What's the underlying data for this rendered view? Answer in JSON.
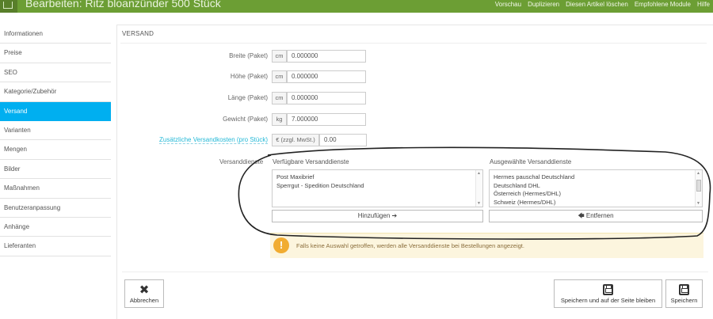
{
  "header": {
    "title": "Bearbeiten: Ritz bloanzünder 500 Stück",
    "actions": [
      "Vorschau",
      "Duplizieren",
      "Diesen Artikel löschen",
      "Empfohlene Module",
      "Hilfe"
    ]
  },
  "sidebar": {
    "items": [
      "Informationen",
      "Preise",
      "SEO",
      "Kategorie/Zubehör",
      "Versand",
      "Varianten",
      "Mengen",
      "Bilder",
      "Maßnahmen",
      "Benutzeranpassung",
      "Anhänge",
      "Lieferanten"
    ],
    "active_index": 4
  },
  "section": {
    "title": "VERSAND"
  },
  "fields": {
    "width": {
      "label": "Breite (Paket)",
      "unit": "cm",
      "value": "0.000000"
    },
    "height": {
      "label": "Höhe (Paket)",
      "unit": "cm",
      "value": "0.000000"
    },
    "depth": {
      "label": "Länge (Paket)",
      "unit": "cm",
      "value": "0.000000"
    },
    "weight": {
      "label": "Gewicht (Paket)",
      "unit": "kg",
      "value": "7.000000"
    },
    "extra_cost": {
      "label": "Zusätzliche Versandkosten (pro Stück)",
      "unit": "€ (zzgl. MwSt.)",
      "value": "0.00"
    }
  },
  "carriers": {
    "label": "Versanddienste",
    "available_title": "Verfügbare Versanddienste",
    "available": [
      "Post Maxibrief",
      "Sperrgut - Spedition Deutschland"
    ],
    "selected_title": "Ausgewählte Versanddienste",
    "selected": [
      "Hermes pauschal Deutschland",
      "Deutschland DHL",
      "Österreich (Hermes/DHL)",
      "Schweiz (Hermes/DHL)"
    ],
    "add_label": "Hinzufügen ➔",
    "remove_label": "🡄 Entfernen"
  },
  "alert": {
    "icon": "!",
    "text": "Falls keine Auswahl getroffen, werden alle Versanddienste bei Bestellungen angezeigt."
  },
  "footer": {
    "cancel_icon": "✖",
    "cancel": "Abbrechen",
    "save_stay": "Speichern und auf der Seite bleiben",
    "save": "Speichern"
  },
  "colors": {
    "topbar": "#6c9e34",
    "active": "#00aff0",
    "link": "#25b9d7",
    "alert_bg": "#fcf5de",
    "alert_icon": "#f1ac31"
  }
}
